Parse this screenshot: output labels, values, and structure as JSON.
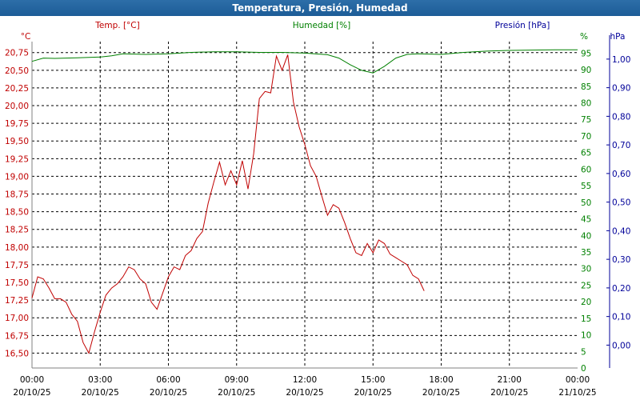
{
  "window": {
    "title": "Temperatura, Presión, Humedad"
  },
  "colors": {
    "temperature": "#c00000",
    "humidity": "#008000",
    "pressure": "#000099",
    "titlebar": "#1f5f9c",
    "grid": "#000000"
  },
  "chart_data": {
    "type": "line",
    "title": "Temperatura, Presión, Humedad",
    "grid": true,
    "x_ticks": [
      {
        "time": "00:00",
        "date": "20/10/25"
      },
      {
        "time": "03:00",
        "date": "20/10/25"
      },
      {
        "time": "06:00",
        "date": "20/10/25"
      },
      {
        "time": "09:00",
        "date": "20/10/25"
      },
      {
        "time": "12:00",
        "date": "20/10/25"
      },
      {
        "time": "15:00",
        "date": "20/10/25"
      },
      {
        "time": "18:00",
        "date": "20/10/25"
      },
      {
        "time": "21:00",
        "date": "20/10/25"
      },
      {
        "time": "00:00",
        "date": "21/10/25"
      }
    ],
    "axes": {
      "temperature": {
        "label": "Temp. [°C]",
        "unit": "°C",
        "range": [
          16.29,
          20.86
        ],
        "ticks": [
          "16,50",
          "16,75",
          "17,00",
          "17,25",
          "17,50",
          "17,75",
          "18,00",
          "18,25",
          "18,50",
          "18,75",
          "19,00",
          "19,25",
          "19,50",
          "19,75",
          "20,00",
          "20,25",
          "20,50",
          "20,75"
        ]
      },
      "humidity": {
        "label": "Humedad [%]",
        "unit": "%",
        "range": [
          0,
          97.5
        ],
        "ticks": [
          "0",
          "5",
          "10",
          "15",
          "20",
          "25",
          "30",
          "35",
          "40",
          "45",
          "50",
          "55",
          "60",
          "65",
          "70",
          "75",
          "80",
          "85",
          "90",
          "95"
        ]
      },
      "pressure": {
        "label": "Presión [hPa]",
        "unit": "hPa",
        "range": [
          -0.08,
          1.05
        ],
        "ticks": [
          "0,00",
          "0,10",
          "0,20",
          "0,30",
          "0,40",
          "0,50",
          "0,60",
          "0,70",
          "0,80",
          "0,90",
          "1,00"
        ]
      }
    },
    "series": [
      {
        "name": "Temp. [°C]",
        "axis": "temperature",
        "x_hours": [
          0,
          0.25,
          0.5,
          0.75,
          1,
          1.25,
          1.5,
          1.75,
          2,
          2.25,
          2.5,
          2.75,
          3,
          3.25,
          3.5,
          3.75,
          4,
          4.25,
          4.5,
          4.75,
          5,
          5.25,
          5.5,
          5.75,
          6,
          6.25,
          6.5,
          6.75,
          7,
          7.25,
          7.5,
          7.75,
          8,
          8.25,
          8.5,
          8.75,
          9,
          9.25,
          9.5,
          9.75,
          10,
          10.25,
          10.5,
          10.75,
          11,
          11.25,
          11.5,
          11.75,
          12,
          12.25,
          12.5,
          12.75,
          13,
          13.25,
          13.5,
          13.75,
          14,
          14.25,
          14.5,
          14.75,
          15,
          15.25,
          15.5,
          15.75,
          16,
          16.25,
          16.5,
          16.75,
          17,
          17.25,
          17.5,
          17.75,
          18,
          18.25,
          18.5,
          18.75,
          19,
          19.25,
          19.5,
          19.75,
          20,
          20.25,
          20.5,
          20.75,
          21,
          21.25,
          21.5,
          21.75,
          22,
          22.25,
          22.5,
          22.75,
          23,
          23.25,
          23.5,
          23.75,
          24
        ],
        "values": [
          17.28,
          17.58,
          17.55,
          17.42,
          17.27,
          17.27,
          17.22,
          17.05,
          16.95,
          16.65,
          16.5,
          16.8,
          17.08,
          17.32,
          17.42,
          17.48,
          17.58,
          17.72,
          17.68,
          17.55,
          17.48,
          17.22,
          17.12,
          17.35,
          17.58,
          17.72,
          17.68,
          17.88,
          17.95,
          18.12,
          18.22,
          18.62,
          18.92,
          19.2,
          18.88,
          19.08,
          18.88,
          19.22,
          18.82,
          19.32,
          20.1,
          20.2,
          20.18,
          20.7,
          20.5,
          20.72,
          20.05,
          19.7,
          19.45,
          19.15,
          19.0,
          18.72,
          18.45,
          18.6,
          18.55,
          18.35,
          18.12,
          17.92,
          17.88,
          18.05,
          17.92,
          18.1,
          18.05,
          17.9,
          17.85,
          17.8,
          17.75,
          17.6,
          17.55,
          17.38
        ]
      },
      {
        "name": "Humedad [%]",
        "axis": "humidity",
        "x_hours": [
          0,
          0.5,
          1,
          2,
          3,
          3.5,
          4,
          5,
          6,
          7,
          8,
          9,
          10,
          11,
          12,
          13,
          13.5,
          14,
          14.5,
          15,
          15.5,
          16,
          16.5,
          17,
          18,
          19,
          20,
          21,
          22,
          23,
          24
        ],
        "values": [
          92.5,
          93.5,
          93.4,
          93.6,
          93.8,
          94.2,
          94.8,
          94.6,
          94.8,
          95.2,
          95.4,
          95.4,
          95.2,
          95.2,
          95.0,
          94.5,
          93.5,
          91.5,
          89.8,
          89.0,
          91.0,
          93.5,
          94.6,
          94.8,
          94.6,
          95.2,
          95.6,
          95.8,
          95.9,
          96.0,
          96.0
        ]
      }
    ]
  }
}
